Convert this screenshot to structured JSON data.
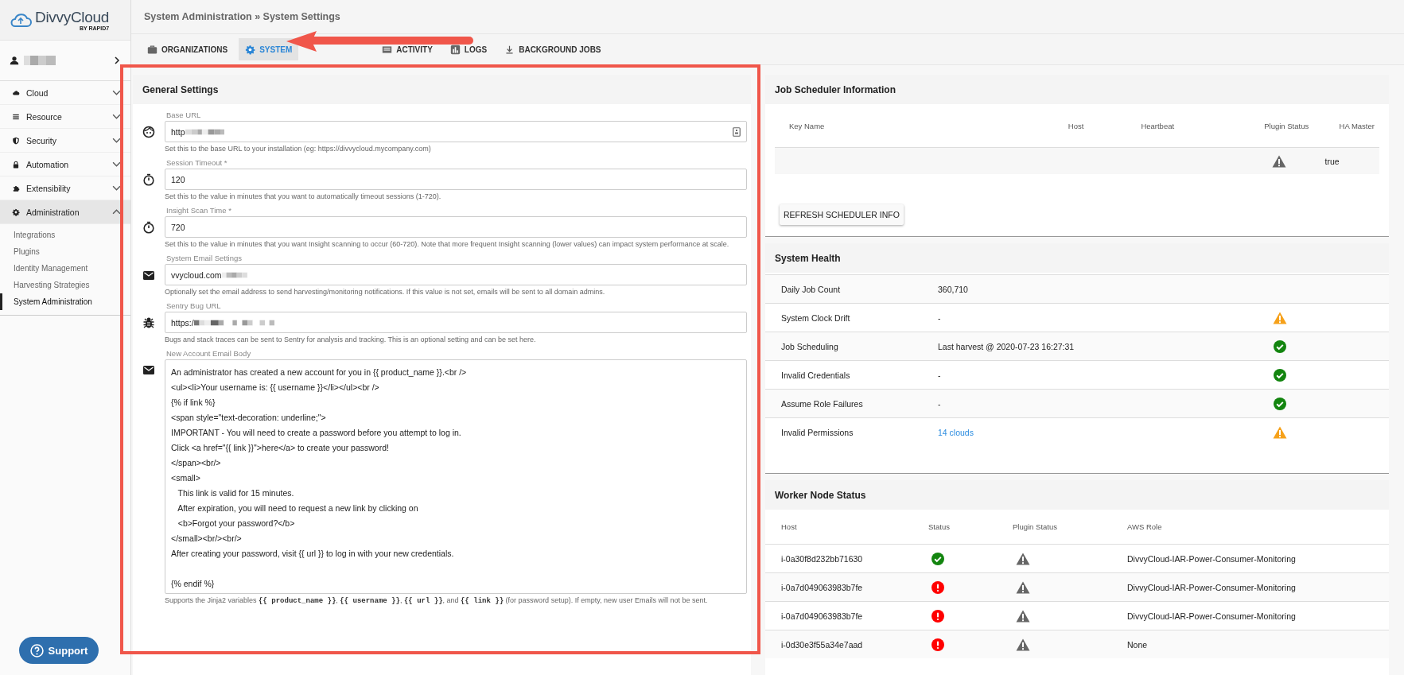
{
  "brand": {
    "name": "DivvyCloud",
    "byline": "BY RAPID7"
  },
  "nav": [
    {
      "label": "Cloud",
      "expanded": false
    },
    {
      "label": "Resource",
      "expanded": false
    },
    {
      "label": "Security",
      "expanded": false
    },
    {
      "label": "Automation",
      "expanded": false
    },
    {
      "label": "Extensibility",
      "expanded": false
    },
    {
      "label": "Administration",
      "expanded": true,
      "children": [
        {
          "label": "Integrations",
          "selected": false
        },
        {
          "label": "Plugins",
          "selected": false
        },
        {
          "label": "Identity Management",
          "selected": false
        },
        {
          "label": "Harvesting Strategies",
          "selected": false
        },
        {
          "label": "System Administration",
          "selected": true
        }
      ]
    }
  ],
  "support_button": "Support",
  "breadcrumb": "System Administration » System Settings",
  "tabs": [
    {
      "label": "ORGANIZATIONS",
      "selected": false
    },
    {
      "label": "SYSTEM",
      "selected": true
    },
    {
      "label": "ACTIVITY",
      "selected": false
    },
    {
      "label": "LOGS",
      "selected": false
    },
    {
      "label": "BACKGROUND JOBS",
      "selected": false
    }
  ],
  "general_settings": {
    "title": "General Settings",
    "fields": [
      {
        "kind": "input",
        "label": "Base URL",
        "value": "http",
        "redacted": true,
        "hint": "Set this to the base URL to your installation (eg: https://divvycloud.mycompany.com)"
      },
      {
        "kind": "input",
        "label": "Session Timeout *",
        "value": "120",
        "redacted": false,
        "hint": "Set this to the value in minutes that you want to automatically timeout sessions (1-720)."
      },
      {
        "kind": "input",
        "label": "Insight Scan Time *",
        "value": "720",
        "redacted": false,
        "hint": "Set this to the value in minutes that you want Insight scanning to occur (60-720). Note that more frequent Insight scanning (lower values) can impact system performance at scale."
      },
      {
        "kind": "input",
        "label": "System Email Settings",
        "value": "vvycloud.com",
        "redacted": true,
        "hint": "Optionally set the email address to send harvesting/monitoring notifications. If this value is not set, emails will be sent to all domain admins."
      },
      {
        "kind": "input",
        "label": "Sentry Bug URL",
        "value": "https:/",
        "redacted": true,
        "hint": "Bugs and stack traces can be sent to Sentry for analysis and tracking. This is an optional setting and can be set here."
      },
      {
        "kind": "textarea",
        "label": "New Account Email Body",
        "value": "An administrator has created a new account for you in {{ product_name }}.<br />\n<ul><li>Your username is: {{ username }}</li></ul><br />\n{% if link %}\n<span style=\"text-decoration: underline;\">\nIMPORTANT - You will need to create a password before you attempt to log in.\nClick <a href=\"{{ link }}\">here</a> to create your password!\n</span><br/>\n<small>\n   This link is valid for 15 minutes.\n   After expiration, you will need to request a new link by clicking on\n   <b>Forgot your password?</b>\n</small><br/><br/>\nAfter creating your password, visit {{ url }} to log in with your new credentials.\n\n{% endif %}",
        "hint_parts": [
          {
            "kind": "plain",
            "text": "Supports the Jinja2 variables "
          },
          {
            "kind": "code",
            "text": "{{ product_name }}"
          },
          {
            "kind": "plain",
            "text": ", "
          },
          {
            "kind": "code",
            "text": "{{ username }}"
          },
          {
            "kind": "plain",
            "text": ", "
          },
          {
            "kind": "code",
            "text": "{{ url }}"
          },
          {
            "kind": "plain",
            "text": ", and "
          },
          {
            "kind": "code",
            "text": "{{ link }}"
          },
          {
            "kind": "plain",
            "text": " (for password setup). If empty, new user Emails will not be sent."
          }
        ]
      }
    ]
  },
  "job_scheduler": {
    "title": "Job Scheduler Information",
    "columns": [
      "Key Name",
      "Host",
      "Heartbeat",
      "Plugin Status",
      "HA Master"
    ],
    "rows": [
      {
        "plugin_warning": true,
        "ha_master": "true"
      }
    ],
    "refresh_button": "REFRESH SCHEDULER INFO"
  },
  "system_health": {
    "title": "System Health",
    "rows": [
      {
        "name": "Daily Job Count",
        "value": "360,710",
        "link": false,
        "kind": "plain"
      },
      {
        "name": "System Clock Drift",
        "value": "-",
        "link": false,
        "kind": "warning"
      },
      {
        "name": "Job Scheduling",
        "value": "Last harvest @ 2020-07-23 16:27:31",
        "link": false,
        "kind": "ok"
      },
      {
        "name": "Invalid Credentials",
        "value": "-",
        "link": false,
        "kind": "ok"
      },
      {
        "name": "Assume Role Failures",
        "value": "-",
        "link": false,
        "kind": "ok"
      },
      {
        "name": "Invalid Permissions",
        "value": "14 clouds",
        "link": true,
        "kind": "warning"
      }
    ]
  },
  "worker_nodes": {
    "title": "Worker Node Status",
    "columns": [
      "Host",
      "Status",
      "Plugin Status",
      "AWS Role"
    ],
    "rows": [
      {
        "host": "i-0a30f8d232bb71630",
        "healthy": true,
        "plugin_warning": true,
        "aws_role": "DivvyCloud-IAR-Power-Consumer-Monitoring"
      },
      {
        "host": "i-0a7d049063983b7fe",
        "healthy": false,
        "plugin_warning": true,
        "aws_role": "DivvyCloud-IAR-Power-Consumer-Monitoring"
      },
      {
        "host": "i-0a7d049063983b7fe",
        "healthy": false,
        "plugin_warning": true,
        "aws_role": "DivvyCloud-IAR-Power-Consumer-Monitoring"
      },
      {
        "host": "i-0d30e3f55a34e7aad",
        "healthy": false,
        "plugin_warning": true,
        "aws_role": "None"
      }
    ]
  }
}
